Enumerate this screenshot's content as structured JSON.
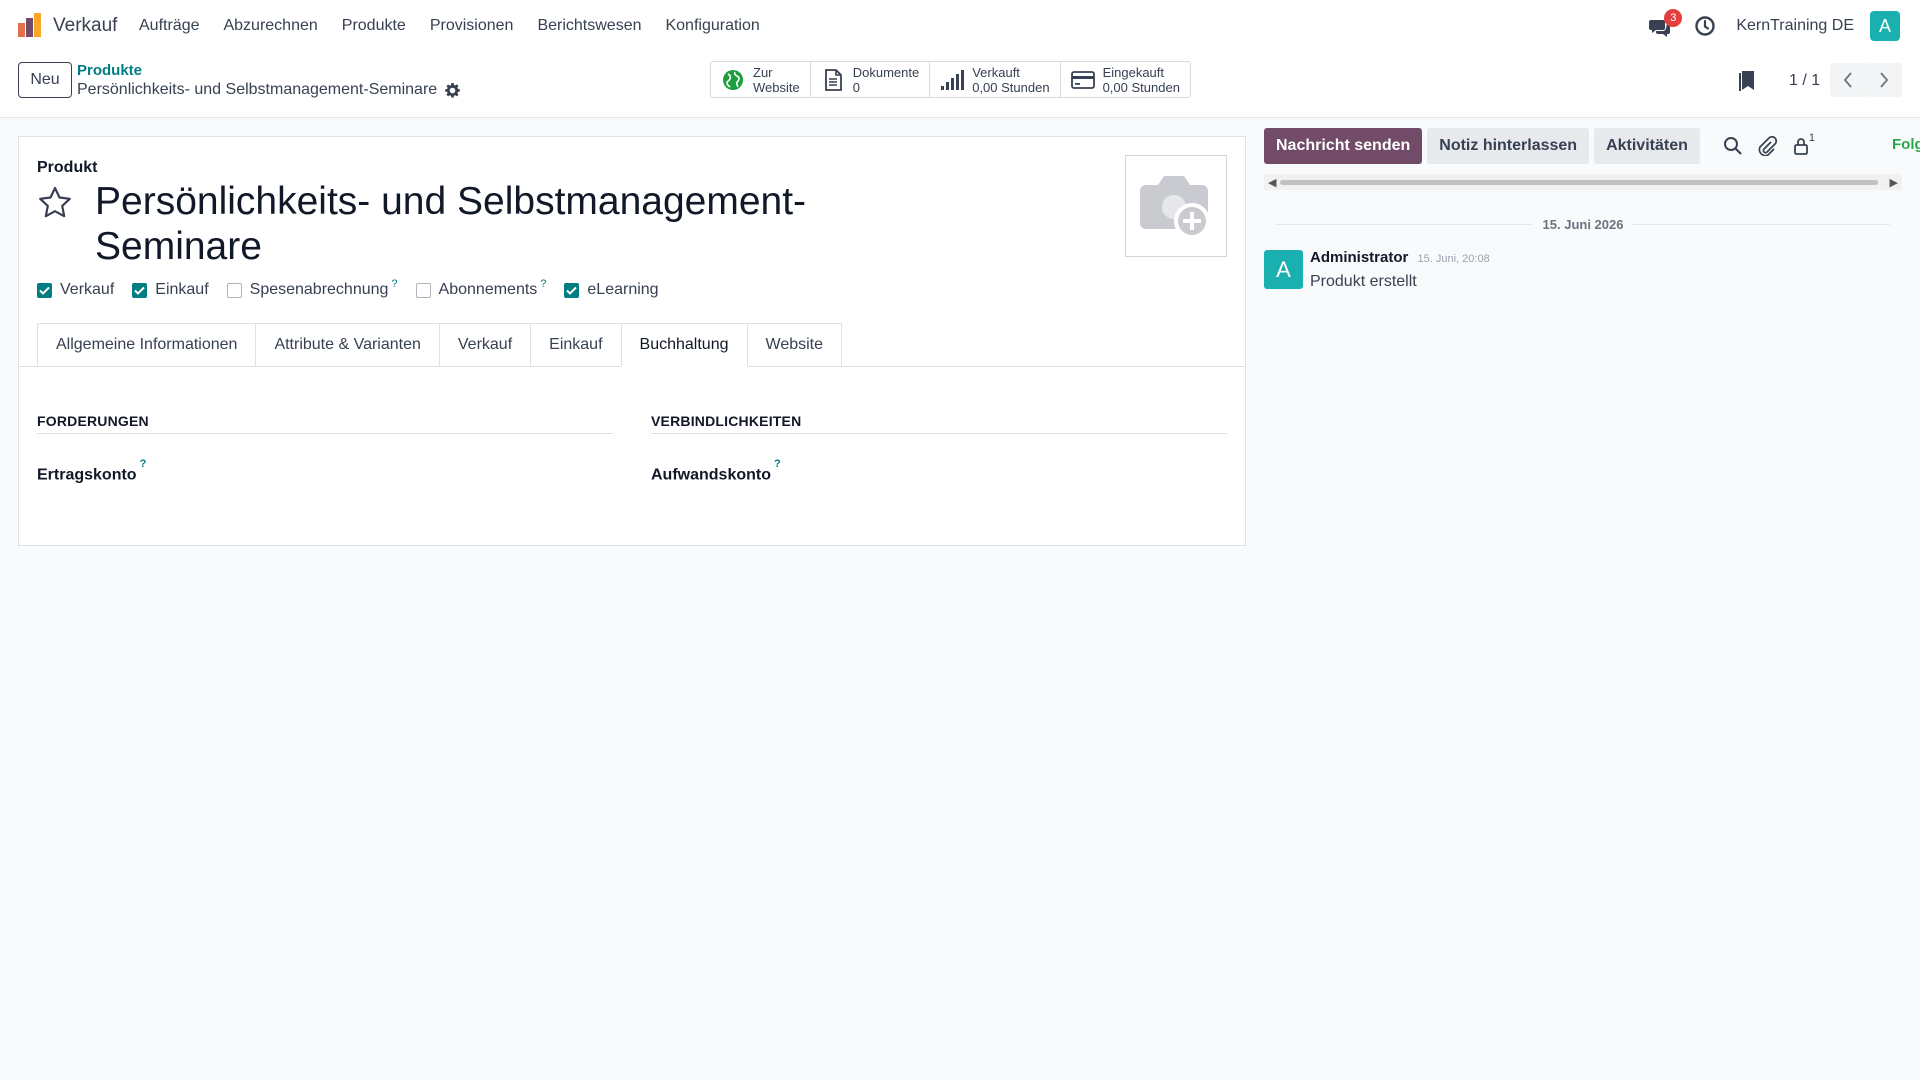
{
  "nav": {
    "app_name": "Verkauf",
    "menu": [
      "Aufträge",
      "Abzurechnen",
      "Produkte",
      "Provisionen",
      "Berichtswesen",
      "Konfiguration"
    ],
    "chat_badge": "3",
    "company": "KernTraining DE",
    "user_initial": "A"
  },
  "control": {
    "new_label": "Neu",
    "breadcrumb_parent": "Produkte",
    "breadcrumb_current": "Persönlichkeits- und Selbstmanagement-Seminare",
    "smart_buttons": [
      {
        "label": "Zur",
        "value": "Website",
        "icon": "globe-icon"
      },
      {
        "label": "Dokumente",
        "value": "0",
        "icon": "document-icon"
      },
      {
        "label": "Verkauft",
        "value": "0,00 Stunden",
        "icon": "signal-bars-icon"
      },
      {
        "label": "Eingekauft",
        "value": "0,00 Stunden",
        "icon": "credit-card-icon"
      }
    ],
    "pager": "1 / 1"
  },
  "form": {
    "type_label": "Produkt",
    "title": "Persönlichkeits- und Selbstmanagement-Seminare",
    "checkboxes": [
      {
        "label": "Verkauf",
        "checked": true,
        "help": ""
      },
      {
        "label": "Einkauf",
        "checked": true,
        "help": ""
      },
      {
        "label": "Spesenabrechnung",
        "checked": false,
        "help": "?"
      },
      {
        "label": "Abonnements",
        "checked": false,
        "help": "?"
      },
      {
        "label": "eLearning",
        "checked": true,
        "help": ""
      }
    ],
    "tabs": [
      "Allgemeine Informationen",
      "Attribute & Varianten",
      "Verkauf",
      "Einkauf",
      "Buchhaltung",
      "Website"
    ],
    "active_tab": "Buchhaltung",
    "sections": [
      {
        "title": "FORDERUNGEN",
        "field": "Ertragskonto",
        "help": "?"
      },
      {
        "title": "VERBINDLICHKEITEN",
        "field": "Aufwandskonto",
        "help": "?"
      }
    ]
  },
  "chatter": {
    "send_message": "Nachricht senden",
    "log_note": "Notiz hinterlassen",
    "activities": "Aktivitäten",
    "follower_count": "1",
    "follow": "Folgen",
    "date_separator": "15. Juni 2026",
    "message": {
      "avatar": "A",
      "author": "Administrator",
      "date": "15. Juni, 20:08",
      "body": "Produkt erstellt"
    }
  },
  "colors": {
    "primary": "#714b67",
    "accent": "#017e84",
    "avatar": "#1ab0b0",
    "badge": "#e53e3e"
  }
}
